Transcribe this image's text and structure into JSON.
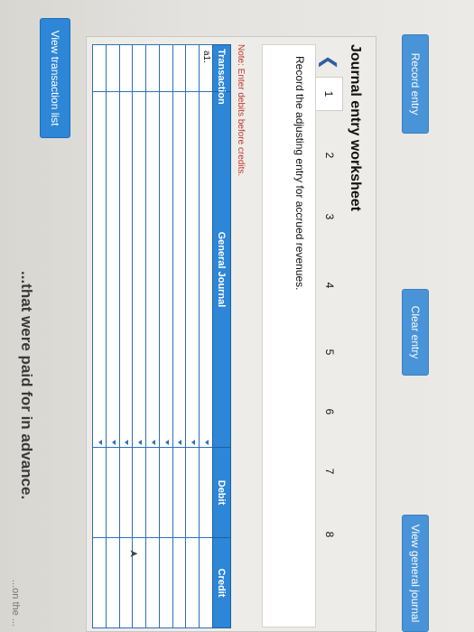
{
  "header": {
    "top_text": "...that were paid for in advance.",
    "top_right_text": "...on the ..."
  },
  "buttons": {
    "view_transaction_list": "View transaction list",
    "record_entry": "Record entry",
    "clear_entry": "Clear entry",
    "view_general_journal": "View general journal"
  },
  "worksheet": {
    "title": "Journal entry worksheet",
    "pages": [
      "1",
      "2",
      "3",
      "4",
      "5",
      "6",
      "7",
      "8"
    ],
    "active_page": "1",
    "instruction": "Record the adjusting entry for accrued revenues.",
    "note": "Note: Enter debits before credits."
  },
  "table": {
    "headers": {
      "transaction": "Transaction",
      "general_journal": "General Journal",
      "debit": "Debit",
      "credit": "Credit"
    },
    "rows": [
      {
        "transaction": "a1.",
        "account": "",
        "debit": "",
        "credit": ""
      },
      {
        "transaction": "",
        "account": "",
        "debit": "",
        "credit": ""
      },
      {
        "transaction": "",
        "account": "",
        "debit": "",
        "credit": ""
      },
      {
        "transaction": "",
        "account": "",
        "debit": "",
        "credit": ""
      },
      {
        "transaction": "",
        "account": "",
        "debit": "",
        "credit": ""
      },
      {
        "transaction": "",
        "account": "",
        "debit": "",
        "credit": ""
      },
      {
        "transaction": "",
        "account": "",
        "debit": "",
        "credit": ""
      },
      {
        "transaction": "",
        "account": "",
        "debit": "",
        "credit": ""
      },
      {
        "transaction": "",
        "account": "",
        "debit": "",
        "credit": ""
      }
    ]
  },
  "colors": {
    "accent": "#2d86d6",
    "note_red": "#c0392b"
  }
}
